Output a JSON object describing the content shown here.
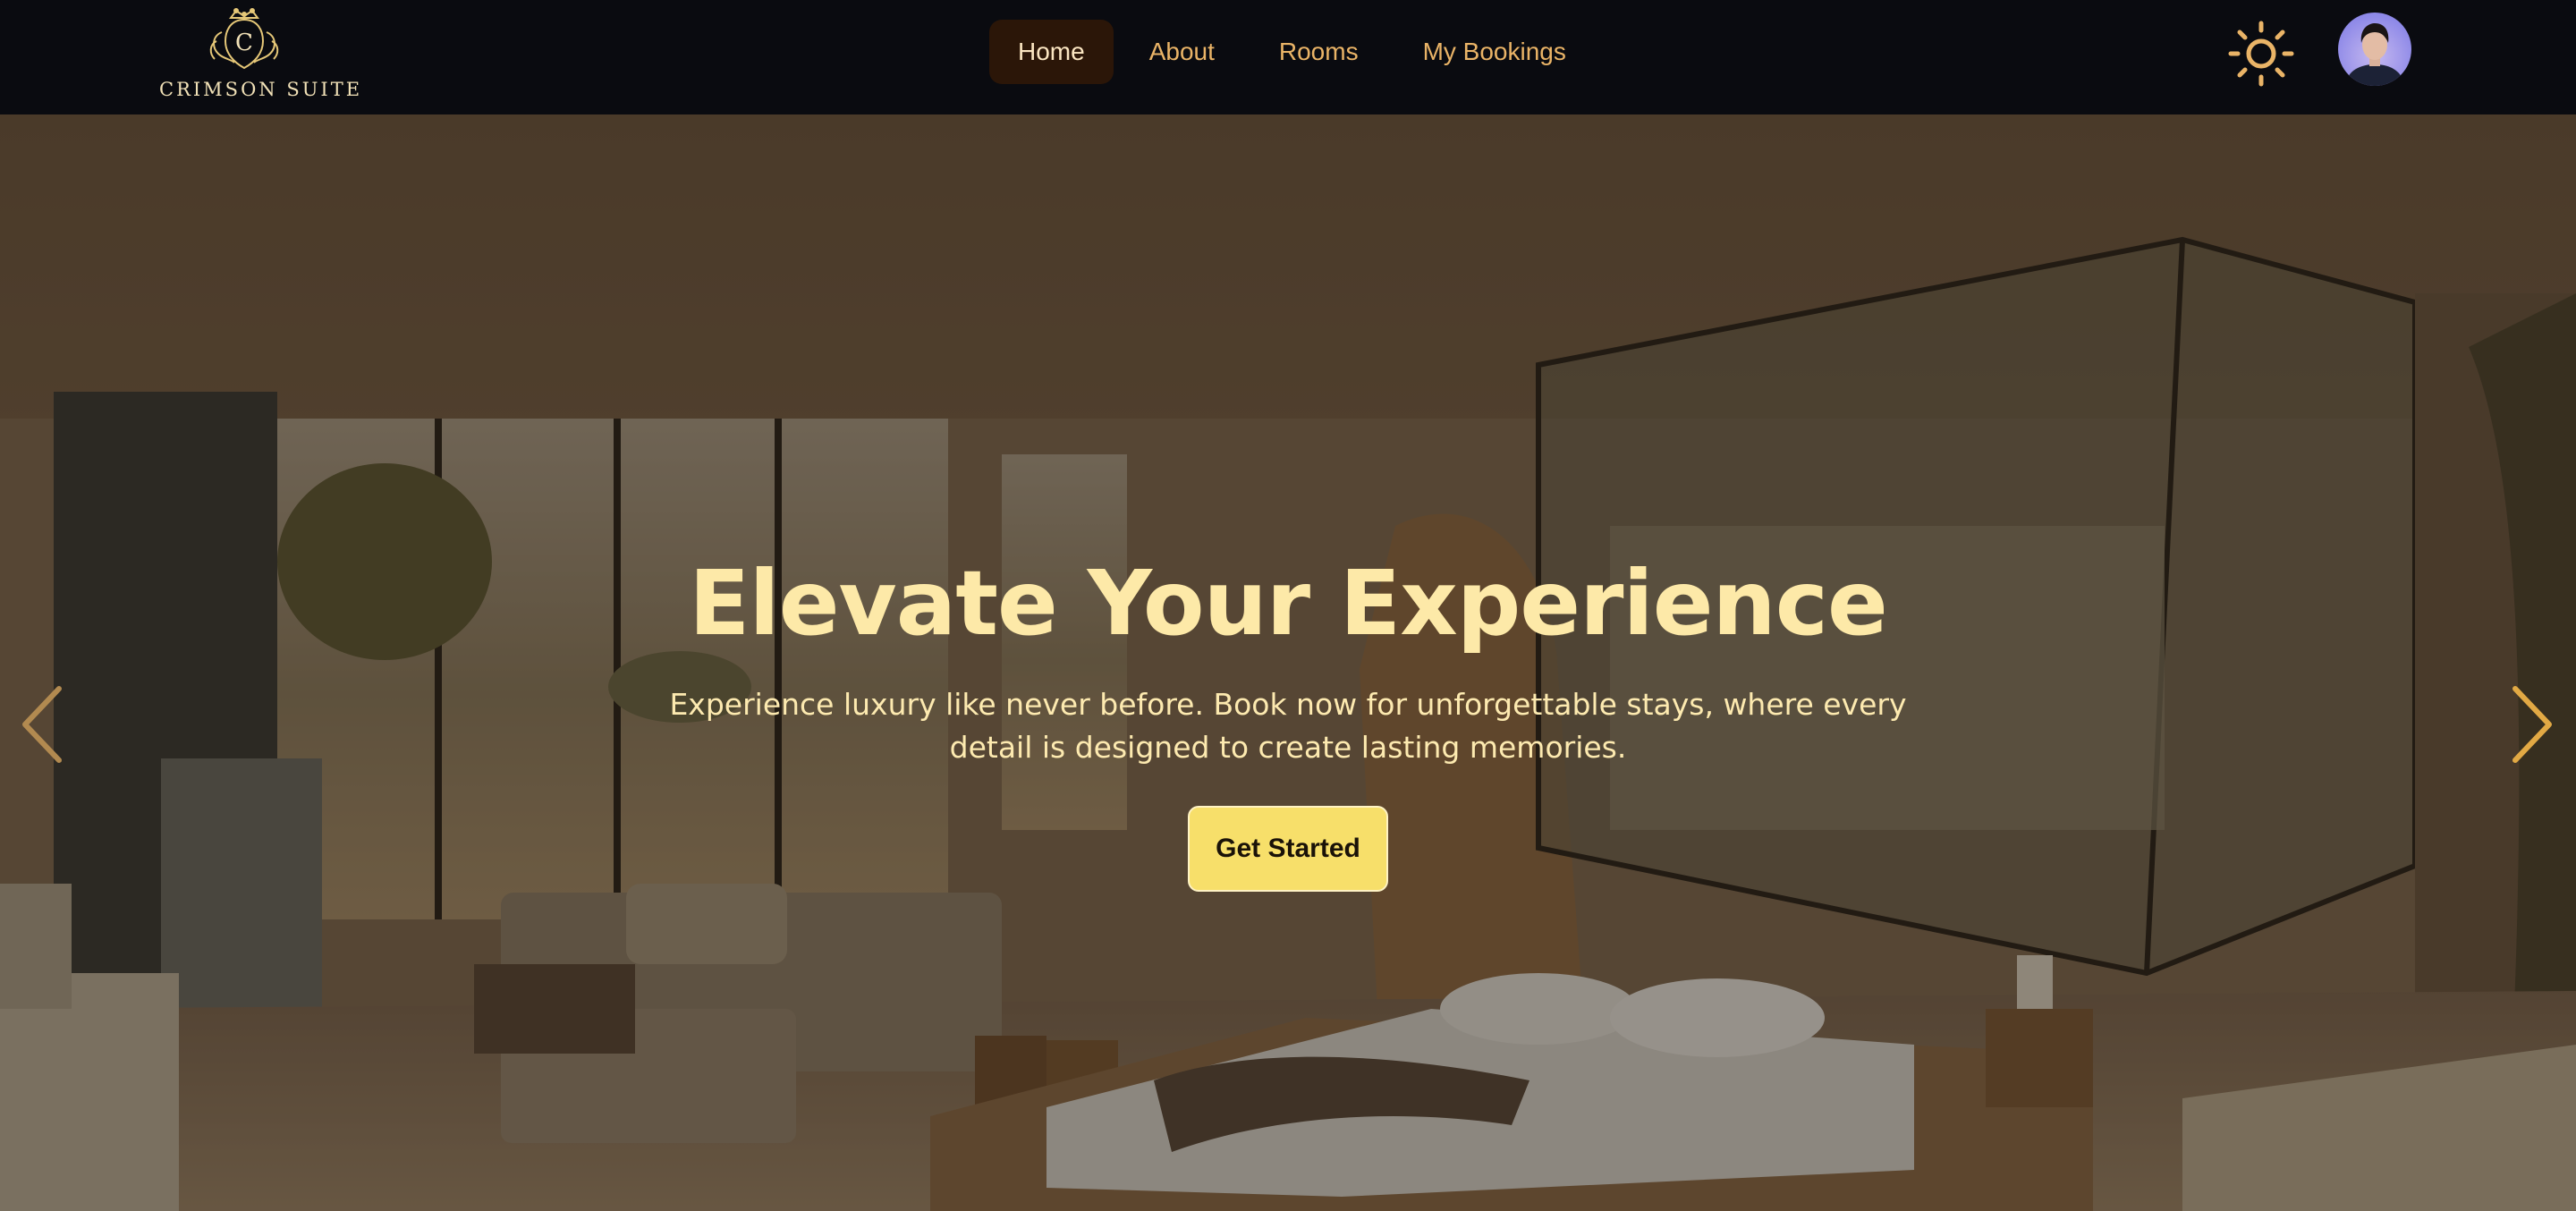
{
  "brand": {
    "name": "CRIMSON SUITE",
    "monogram": "C"
  },
  "nav": {
    "items": [
      {
        "label": "Home",
        "active": true
      },
      {
        "label": "About",
        "active": false
      },
      {
        "label": "Rooms",
        "active": false
      },
      {
        "label": "My Bookings",
        "active": false
      }
    ]
  },
  "header_icons": {
    "theme_toggle": "sun-icon",
    "profile": "user-avatar"
  },
  "hero": {
    "title": "Elevate Your Experience",
    "subtitle": "Experience luxury like never before. Book now for unforgettable stays, where every detail is designed to create lasting memories.",
    "cta_label": "Get Started",
    "prev_icon": "chevron-left-icon",
    "next_icon": "chevron-right-icon"
  },
  "colors": {
    "background": "#0a0b10",
    "accent": "#eab467",
    "active_nav_bg": "#2b1608",
    "title": "#fde9a8",
    "cta": "#f7df6a"
  }
}
